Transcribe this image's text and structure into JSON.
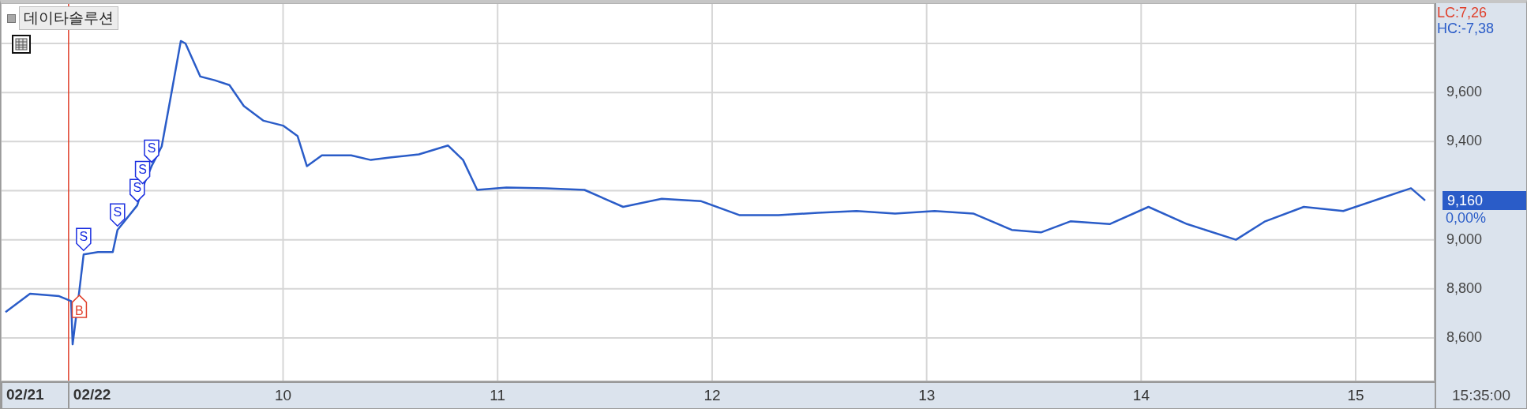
{
  "chart_title": "데이타솔루션",
  "chart": {
    "chart_data": {
      "type": "line",
      "x": [
        8.706,
        8.82,
        8.956,
        9.012,
        9.019,
        9.05,
        9.07,
        9.137,
        9.206,
        9.228,
        9.32,
        9.345,
        9.387,
        9.434,
        9.478,
        9.523,
        9.545,
        9.614,
        9.681,
        9.75,
        9.817,
        9.909,
        10.0,
        10.067,
        10.111,
        10.181,
        10.317,
        10.409,
        10.497,
        10.633,
        10.769,
        10.839,
        10.905,
        11.041,
        11.225,
        11.405,
        11.585,
        11.765,
        11.949,
        12.129,
        12.309,
        12.493,
        12.673,
        12.853,
        13.037,
        13.217,
        13.397,
        13.533,
        13.67,
        13.853,
        14.034,
        14.214,
        14.442,
        14.578,
        14.758,
        14.942,
        15.122,
        15.258,
        15.324
      ],
      "series": [
        {
          "color": "#2a5cc8",
          "values": [
            8705,
            8780,
            8770,
            8750,
            8574,
            8790,
            8940,
            8950,
            8950,
            9040,
            9140,
            9213,
            9300,
            9380,
            9590,
            9810,
            9800,
            9665,
            9650,
            9630,
            9545,
            9485,
            9465,
            9423,
            9300,
            9344,
            9344,
            9325,
            9335,
            9348,
            9384,
            9325,
            9203,
            9213,
            9210,
            9203,
            9134,
            9167,
            9157,
            9100,
            9100,
            9110,
            9117,
            9107,
            9117,
            9107,
            9040,
            9030,
            9075,
            9064,
            9134,
            9064,
            9000,
            9075,
            9134,
            9117,
            9170,
            9210,
            9160
          ]
        }
      ],
      "xlim": [
        8.684,
        15.368
      ],
      "ylim": [
        8423,
        9964
      ],
      "xticks": [
        10,
        11,
        12,
        13,
        14,
        15
      ],
      "yticks": [
        {
          "value": 8600,
          "label": "8,600"
        },
        {
          "value": 8800,
          "label": "8,800"
        },
        {
          "value": 9000,
          "label": "9,000"
        },
        {
          "value": 9400,
          "label": "9,400"
        },
        {
          "value": 9600,
          "label": "9,600"
        }
      ],
      "grid": true,
      "ref_lines": [
        {
          "axis": "x",
          "value": 9.0
        }
      ],
      "annotations": [
        {
          "text": "B",
          "x": 9.05,
          "y": 8790
        },
        {
          "text": "S",
          "x": 9.07,
          "y": 8940
        },
        {
          "text": "S",
          "x": 9.228,
          "y": 9040
        },
        {
          "text": "S",
          "x": 9.32,
          "y": 9140
        },
        {
          "text": "S",
          "x": 9.345,
          "y": 9213
        },
        {
          "text": "S",
          "x": 9.387,
          "y": 9300
        }
      ]
    },
    "markers": [
      {
        "kind": "buy"
      },
      {
        "kind": "sell"
      },
      {
        "kind": "sell"
      },
      {
        "kind": "sell"
      },
      {
        "kind": "sell"
      },
      {
        "kind": "sell"
      }
    ]
  },
  "price_axis": {
    "low_change": "LC:7,26",
    "high_change": "HC:-7,38",
    "current_price": "9,160",
    "change_percent": "0,00%"
  },
  "time_axis": {
    "dates": [
      "02/21",
      "02/22"
    ],
    "clock": "15:35:00"
  }
}
